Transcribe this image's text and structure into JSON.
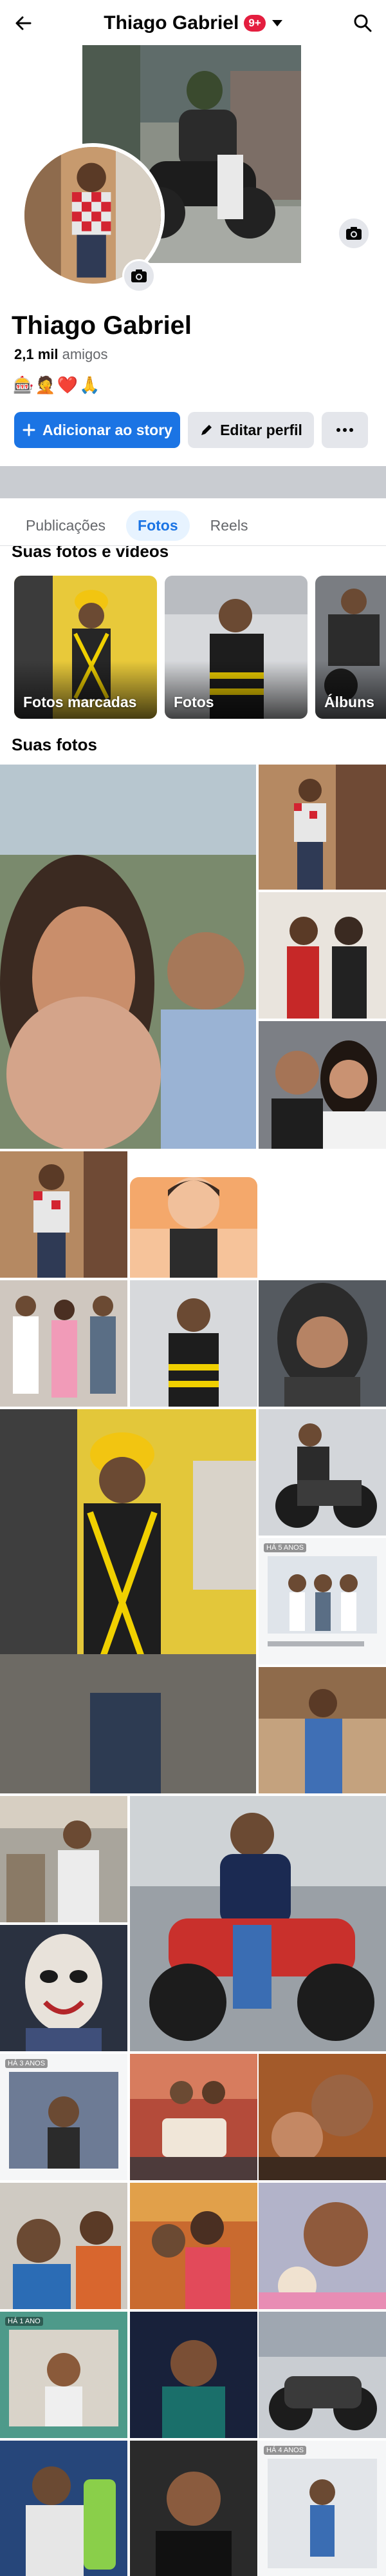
{
  "header": {
    "title": "Thiago Gabriel",
    "badge": "9+",
    "back_icon": "back-arrow-icon",
    "search_icon": "search-icon"
  },
  "profile": {
    "name": "Thiago Gabriel",
    "friends_count": "2,1 mil",
    "friends_label": "amigos",
    "emojis": "🎰🤦❤️🙏"
  },
  "actions": {
    "add_story": "Adicionar ao story",
    "edit_profile": "Editar perfil",
    "more_icon": "more-dots-icon"
  },
  "tabs": [
    {
      "label": "Publicações",
      "active": false
    },
    {
      "label": "Fotos",
      "active": true
    },
    {
      "label": "Reels",
      "active": false
    }
  ],
  "albums_section": {
    "title": "Suas fotos e vídeos",
    "albums": [
      {
        "label": "Fotos marcadas"
      },
      {
        "label": "Fotos"
      },
      {
        "label": "Álbuns"
      }
    ]
  },
  "photos_section": {
    "title": "Suas fotos",
    "overlays": {
      "a": "HÁ 5 ANOS",
      "b": "HÁ 3 ANOS",
      "c": "HÁ 1 ANO",
      "d": "HÁ 4 ANOS"
    }
  },
  "colors": {
    "accent": "#1b74e4",
    "badge": "#e41e3f",
    "divider": "#c9ccd1"
  }
}
